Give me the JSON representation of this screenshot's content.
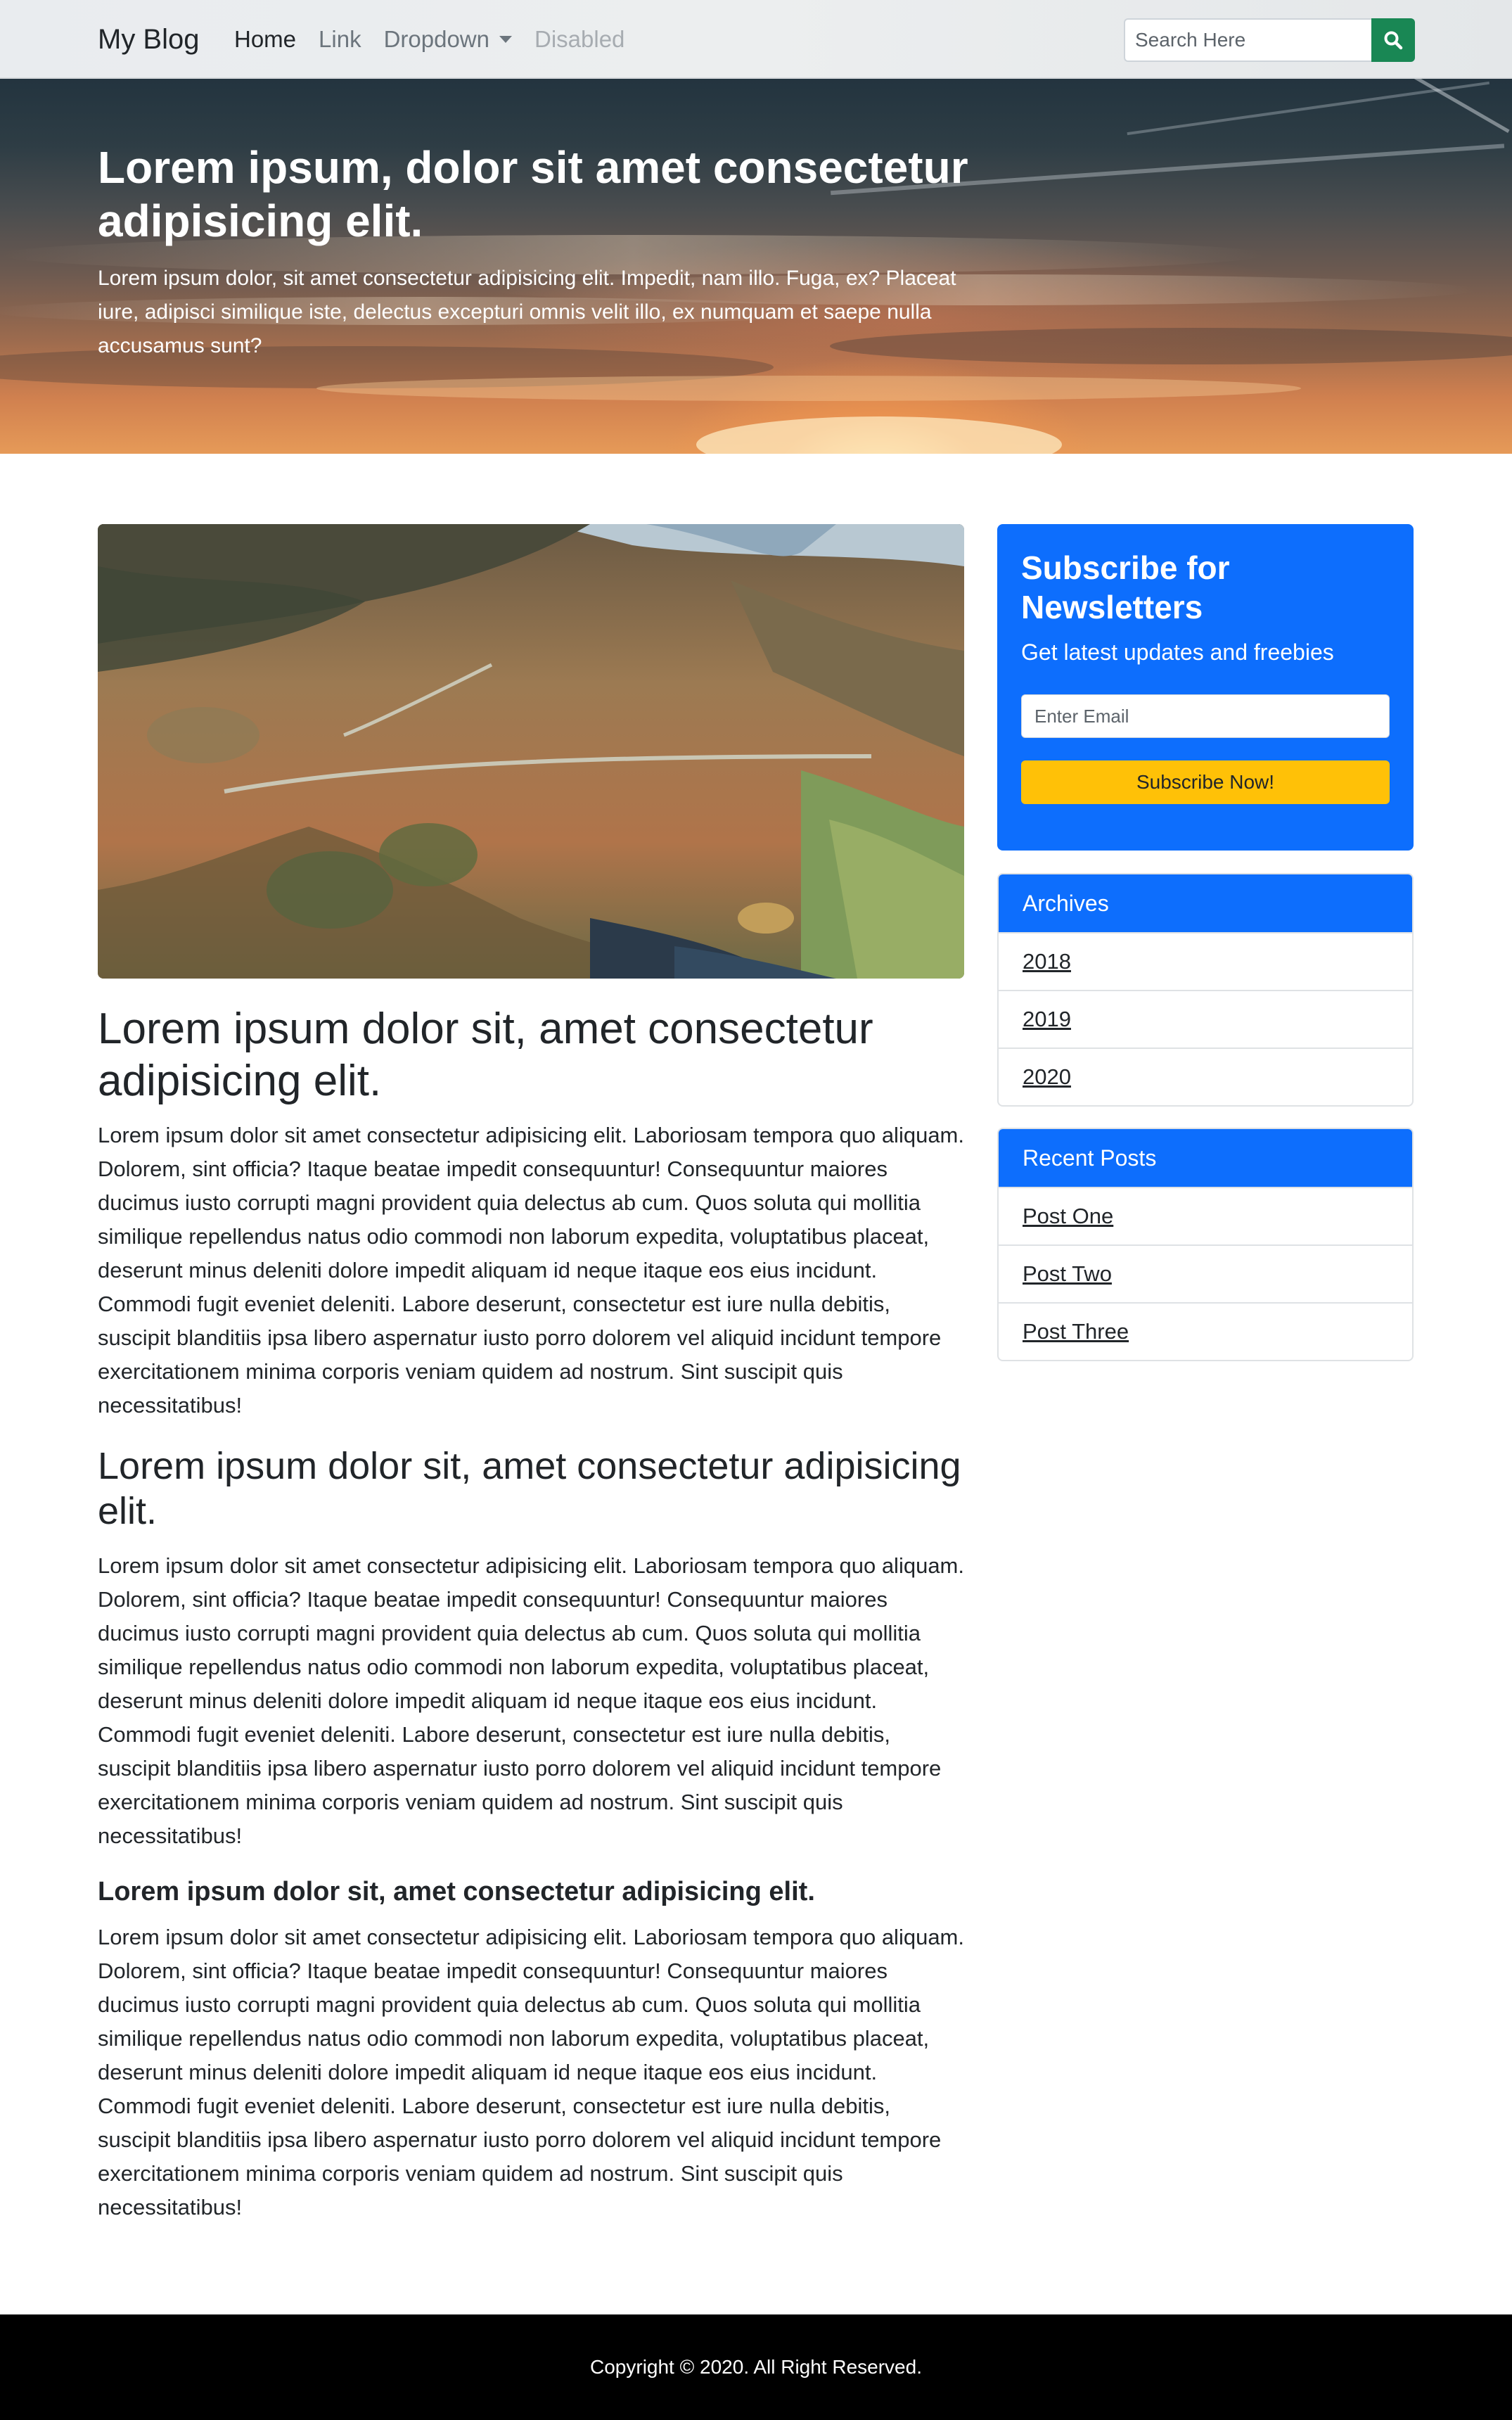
{
  "navbar": {
    "brand": "My Blog",
    "links": [
      {
        "label": "Home"
      },
      {
        "label": "Link"
      },
      {
        "label": "Dropdown"
      },
      {
        "label": "Disabled"
      }
    ],
    "search_placeholder": "Search Here"
  },
  "hero": {
    "title": "Lorem ipsum, dolor sit amet consectetur adipisicing elit.",
    "text": "Lorem ipsum dolor, sit amet consectetur adipisicing elit. Impedit, nam illo. Fuga, ex? Placeat iure, adipisci similique iste, delectus excepturi omnis velit illo, ex numquam et saepe nulla accusamus sunt?"
  },
  "article": {
    "sections": [
      {
        "heading": "Lorem ipsum dolor sit, amet consectetur adipisicing elit.",
        "body": "Lorem ipsum dolor sit amet consectetur adipisicing elit. Laboriosam tempora quo aliquam. Dolorem, sint officia? Itaque beatae impedit consequuntur! Consequuntur maiores ducimus iusto corrupti magni provident quia delectus ab cum. Quos soluta qui mollitia similique repellendus natus odio commodi non laborum expedita, voluptatibus placeat, deserunt minus deleniti dolore impedit aliquam id neque itaque eos eius incidunt. Commodi fugit eveniet deleniti. Labore deserunt, consectetur est iure nulla debitis, suscipit blanditiis ipsa libero aspernatur iusto porro dolorem vel aliquid incidunt tempore exercitationem minima corporis veniam quidem ad nostrum. Sint suscipit quis necessitatibus!"
      },
      {
        "heading": "Lorem ipsum dolor sit, amet consectetur adipisicing elit.",
        "body": "Lorem ipsum dolor sit amet consectetur adipisicing elit. Laboriosam tempora quo aliquam. Dolorem, sint officia? Itaque beatae impedit consequuntur! Consequuntur maiores ducimus iusto corrupti magni provident quia delectus ab cum. Quos soluta qui mollitia similique repellendus natus odio commodi non laborum expedita, voluptatibus placeat, deserunt minus deleniti dolore impedit aliquam id neque itaque eos eius incidunt. Commodi fugit eveniet deleniti. Labore deserunt, consectetur est iure nulla debitis, suscipit blanditiis ipsa libero aspernatur iusto porro dolorem vel aliquid incidunt tempore exercitationem minima corporis veniam quidem ad nostrum. Sint suscipit quis necessitatibus!"
      },
      {
        "heading": "Lorem ipsum dolor sit, amet consectetur adipisicing elit.",
        "body": "Lorem ipsum dolor sit amet consectetur adipisicing elit. Laboriosam tempora quo aliquam. Dolorem, sint officia? Itaque beatae impedit consequuntur! Consequuntur maiores ducimus iusto corrupti magni provident quia delectus ab cum. Quos soluta qui mollitia similique repellendus natus odio commodi non laborum expedita, voluptatibus placeat, deserunt minus deleniti dolore impedit aliquam id neque itaque eos eius incidunt. Commodi fugit eveniet deleniti. Labore deserunt, consectetur est iure nulla debitis, suscipit blanditiis ipsa libero aspernatur iusto porro dolorem vel aliquid incidunt tempore exercitationem minima corporis veniam quidem ad nostrum. Sint suscipit quis necessitatibus!"
      }
    ]
  },
  "sidebar": {
    "subscribe": {
      "title": "Subscribe for Newsletters",
      "subtitle": "Get latest updates and freebies",
      "email_placeholder": "Enter Email",
      "button_label": "Subscribe Now!"
    },
    "archives": {
      "title": "Archives",
      "items": [
        {
          "label": "2018"
        },
        {
          "label": "2019"
        },
        {
          "label": "2020"
        }
      ]
    },
    "recent_posts": {
      "title": "Recent Posts",
      "items": [
        {
          "label": "Post One"
        },
        {
          "label": "Post Two"
        },
        {
          "label": "Post Three"
        }
      ]
    }
  },
  "footer": {
    "text": "Copyright © 2020. All Right Reserved."
  },
  "colors": {
    "primary": "#0d6efd",
    "success": "#198754",
    "warning": "#ffc107",
    "footer_bg": "#000000"
  },
  "icons": {
    "search_button": "search-icon",
    "dropdown": "caret-down-icon"
  }
}
